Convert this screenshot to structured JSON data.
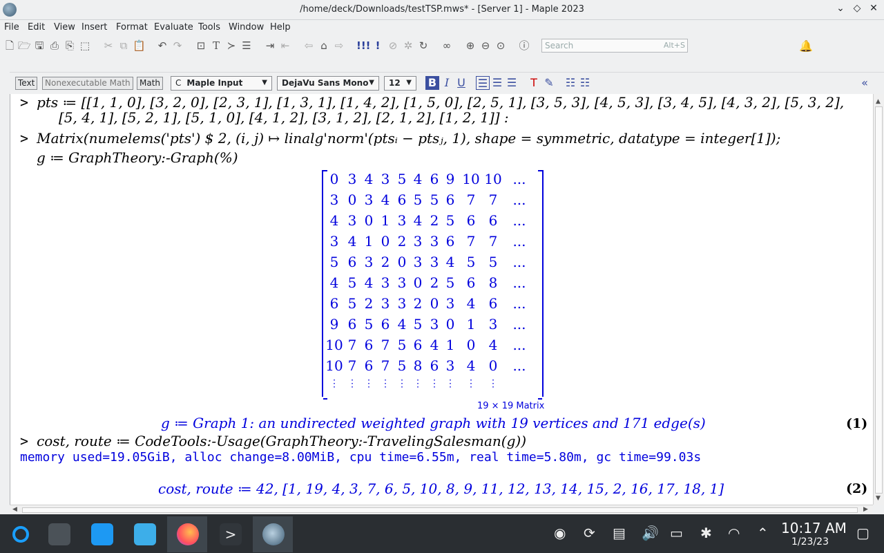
{
  "window": {
    "title": "/home/deck/Downloads/testTSP.mws* - [Server 1] - Maple 2023"
  },
  "menu": [
    "File",
    "Edit",
    "View",
    "Insert",
    "Format",
    "Evaluate",
    "Tools",
    "Window",
    "Help"
  ],
  "search": {
    "placeholder": "Search",
    "shortcut": "Alt+S"
  },
  "format_bar": {
    "mode_text": "Text",
    "mode_nonexec": "Nonexecutable Math",
    "mode_math": "Math",
    "style_value": "Maple Input",
    "font_value": "DejaVu Sans Mono",
    "size_value": "12",
    "style_prefix": "C"
  },
  "worksheet": {
    "pts_line1": "pts ≔ [[1, 1, 0], [3, 2, 0], [2, 3, 1], [1, 3, 1], [1, 4, 2], [1, 5, 0], [2, 5, 1], [3, 5, 3], [4, 5, 3], [3, 4, 5], [4, 3, 2], [5, 3, 2],",
    "pts_line2": "[5, 4, 1], [5, 2, 1], [5, 1, 0], [4, 1, 2], [3, 1, 2], [2, 1, 2], [1, 2, 1]] :",
    "matrix_cmd": "Matrix(numelems('pts') $ 2, (i, j) ↦ linalg'norm'(ptsᵢ − ptsⱼ, 1), shape = symmetric, datatype = integer[1]);",
    "graph_cmd": "g ≔ GraphTheory:-Graph(%)",
    "matrix_rows": [
      [
        "0",
        "3",
        "4",
        "3",
        "5",
        "4",
        "6",
        "9",
        "10",
        "10",
        "..."
      ],
      [
        "3",
        "0",
        "3",
        "4",
        "6",
        "5",
        "5",
        "6",
        "7",
        "7",
        "..."
      ],
      [
        "4",
        "3",
        "0",
        "1",
        "3",
        "4",
        "2",
        "5",
        "6",
        "6",
        "..."
      ],
      [
        "3",
        "4",
        "1",
        "0",
        "2",
        "3",
        "3",
        "6",
        "7",
        "7",
        "..."
      ],
      [
        "5",
        "6",
        "3",
        "2",
        "0",
        "3",
        "3",
        "4",
        "5",
        "5",
        "..."
      ],
      [
        "4",
        "5",
        "4",
        "3",
        "3",
        "0",
        "2",
        "5",
        "6",
        "8",
        "..."
      ],
      [
        "6",
        "5",
        "2",
        "3",
        "3",
        "2",
        "0",
        "3",
        "4",
        "6",
        "..."
      ],
      [
        "9",
        "6",
        "5",
        "6",
        "4",
        "5",
        "3",
        "0",
        "1",
        "3",
        "..."
      ],
      [
        "10",
        "7",
        "6",
        "7",
        "5",
        "6",
        "4",
        "1",
        "0",
        "4",
        "..."
      ],
      [
        "10",
        "7",
        "6",
        "7",
        "5",
        "8",
        "6",
        "3",
        "4",
        "0",
        "..."
      ]
    ],
    "matrix_caption": "19 × 19 Matrix",
    "graph_output": "g ≔ Graph 1: an undirected weighted graph with 19 vertices and 171 edge(s)",
    "label1": "(1)",
    "tsp_cmd": "cost, route ≔ CodeTools:-Usage(GraphTheory:-TravelingSalesman(g))",
    "usage_output": "memory used=19.05GiB, alloc change=8.00MiB, cpu time=6.55m, real time=5.80m, gc time=99.03s",
    "tsp_output": "cost, route ≔ 42, [1, 19, 4, 3, 7, 6, 5, 10, 8, 9, 11, 12, 13, 14, 15, 2, 16, 17, 18, 1]",
    "label2": "(2)"
  },
  "taskbar": {
    "time": "10:17 AM",
    "date": "1/23/23"
  }
}
